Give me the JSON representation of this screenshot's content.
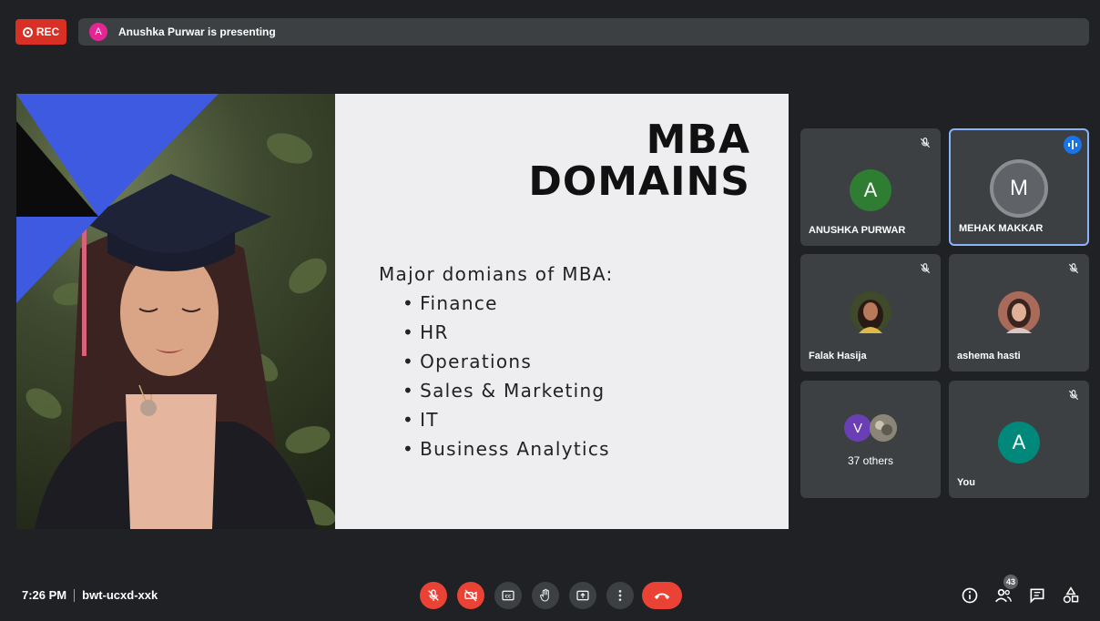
{
  "top_bar": {
    "rec_label": "REC",
    "presenter_initial": "A",
    "presenting_text": "Anushka Purwar is presenting"
  },
  "slide": {
    "title_line1": "MBA",
    "title_line2": "DOMAINS",
    "intro": "Major domians of MBA:",
    "bullets": [
      "Finance",
      "HR",
      "Operations",
      "Sales & Marketing",
      "IT",
      "Business Analytics"
    ]
  },
  "participants": [
    {
      "name": "ANUSHKA PURWAR",
      "initial": "A",
      "avatar_color": "#2e7d32",
      "muted": true
    },
    {
      "name": "MEHAK MAKKAR",
      "initial": "M",
      "avatar_color": "#5f6368",
      "speaking": true
    },
    {
      "name": "Falak Hasija",
      "avatar": "photo",
      "muted": true
    },
    {
      "name": "ashema hasti",
      "avatar": "photo",
      "muted": true
    },
    {
      "others_initial": "V",
      "others_label": "37 others"
    },
    {
      "name": "You",
      "initial": "A",
      "avatar_color": "#00897b",
      "muted": true
    }
  ],
  "bottom_bar": {
    "time": "7:26 PM",
    "meeting_code": "bwt-ucxd-xxk",
    "controls": [
      "mic-off-icon",
      "camera-off-icon",
      "captions-icon",
      "raise-hand-icon",
      "present-icon",
      "more-options-icon",
      "end-call-icon"
    ],
    "right_icons": [
      "info-icon",
      "people-icon",
      "chat-icon",
      "activities-icon"
    ],
    "participant_count": "43"
  },
  "colors": {
    "background": "#202124",
    "tile": "#3c4043",
    "rec_red": "#d93025",
    "accent_blue": "#8ab4f8",
    "slide_triangle": "#3d5ae0"
  }
}
